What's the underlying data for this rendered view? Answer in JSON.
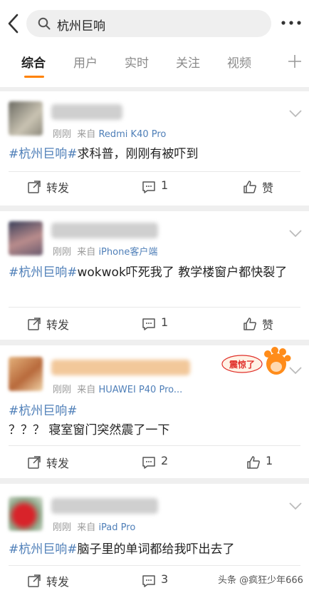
{
  "search": {
    "query": "杭州巨响"
  },
  "tabs": [
    {
      "label": "综合"
    },
    {
      "label": "用户"
    },
    {
      "label": "实时"
    },
    {
      "label": "关注"
    },
    {
      "label": "视频"
    }
  ],
  "colors": {
    "accent": "#ff8200",
    "link": "#4f7fb8"
  },
  "posts": [
    {
      "time": "刚刚",
      "via": "来自",
      "source": "Redmi K40 Pro",
      "hashtag": "#杭州巨响#",
      "text": "求科普，刚刚有被吓到",
      "repost_label": "转发",
      "comment_count": "1",
      "like_label": "赞"
    },
    {
      "time": "刚刚",
      "via": "来自",
      "source": "iPhone客户端",
      "hashtag": "#杭州巨响#",
      "text": "wokwok吓死我了 教学楼窗户都快裂了",
      "repost_label": "转发",
      "comment_count": "1",
      "like_label": "赞"
    },
    {
      "time": "刚刚",
      "via": "来自",
      "source": "HUAWEI P40 Pro...",
      "hashtag": "#杭州巨响#",
      "text": "？？？ 寝室窗门突然震了一下",
      "badge_text": "震惊了",
      "repost_label": "转发",
      "comment_count": "2",
      "like_count": "1"
    },
    {
      "time": "刚刚",
      "via": "来自",
      "source": "iPad Pro",
      "hashtag": "#杭州巨响#",
      "text": "脑子里的单词都给我吓出去了",
      "repost_label": "转发",
      "comment_count": "3"
    }
  ],
  "watermark": {
    "text": "头条 @疯狂少年666"
  }
}
